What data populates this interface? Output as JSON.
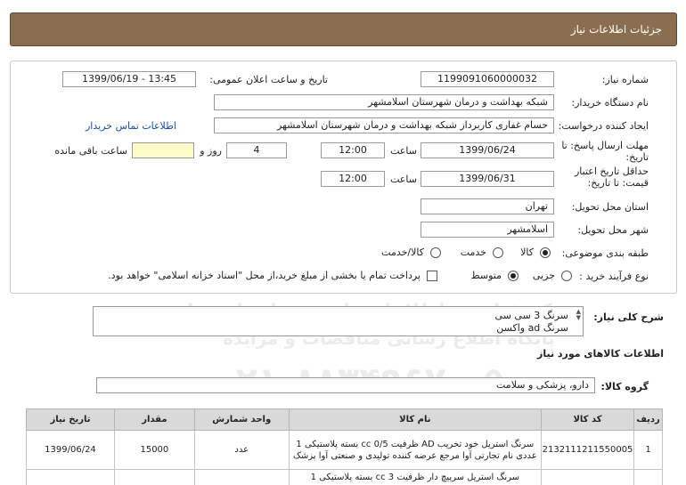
{
  "header": {
    "title": "جزئیات اطلاعات نیاز"
  },
  "form": {
    "need_number_label": "شماره نیاز:",
    "need_number": "1199091060000032",
    "announce_label": "تاریخ و ساعت اعلان عمومی:",
    "announce_value": "1399/06/19 - 13:45",
    "buyer_org_label": "نام دستگاه خریدار:",
    "buyer_org": "شبکه بهداشت و درمان شهرستان اسلامشهر",
    "creator_label": "ایجاد کننده درخواست:",
    "creator": "حسام غفاری کاربرداز شبکه بهداشت و درمان شهرستان اسلامشهر",
    "contact_link": "اطلاعات تماس خریدار",
    "deadline_label_1": "مهلت ارسال پاسخ: تا",
    "deadline_label_2": "تاریخ:",
    "deadline_date": "1399/06/24",
    "time_label": "ساعت",
    "deadline_time": "12:00",
    "days_value": "4",
    "days_label": "روز و",
    "remaining_value": "",
    "remaining_label": "ساعت باقی مانده",
    "validity_label_1": "حداقل تاریخ اعتبار",
    "validity_label_2": "قیمت: تا تاریخ:",
    "validity_date": "1399/06/31",
    "validity_time": "12:00",
    "province_label": "استان محل تحویل:",
    "province": "تهران",
    "city_label": "شهر محل تحویل:",
    "city": "اسلامشهر",
    "category_label": "طبقه بندی موضوعی:",
    "category_options": [
      "کالا",
      "خدمت",
      "کالا/خدمت"
    ],
    "category_selected": "کالا",
    "process_label": "نوع فرآیند خرید :",
    "process_options": [
      "جزیی",
      "متوسط"
    ],
    "process_selected": "متوسط",
    "payment_note": "پرداخت تمام یا بخشی از مبلغ خرید،از محل \"اسناد خزانه اسلامی\" خواهد بود."
  },
  "summary": {
    "label": "شرح کلی نیاز:",
    "line1": "سرنگ 3 سی سی",
    "line2": "سرنگ ad واکسن"
  },
  "goods_info_title": "اطلاعات کالاهای مورد نیاز",
  "goods_group": {
    "label": "گروه کالا:",
    "value": "دارو، پزشکی و سلامت"
  },
  "table": {
    "headers": [
      "ردیف",
      "کد کالا",
      "نام کالا",
      "واحد شمارش",
      "مقدار",
      "تاریخ نیاز"
    ],
    "rows": [
      {
        "index": "1",
        "code": "2132111211550005",
        "name": "سرنگ استریل خود تخریب AD ظرفیت cc 0/5 بسته پلاستیکی 1 عددی نام تجارتی آوا مرجع عرضه کننده تولیدی و صنعتی آوا پزشک",
        "unit": "عدد",
        "qty": "15000",
        "date": "1399/06/24"
      },
      {
        "index": "",
        "code": "",
        "name": "سرنگ استریل سرپیچ دار ظرفیت cc 3 بسته پلاستیکی 1",
        "unit": "",
        "qty": "",
        "date": ""
      }
    ]
  },
  "watermark": {
    "line1": "مرکز فناوری اطلاعات پارس نماد داده ها",
    "line2": "پایگاه اطلاع رسانی مناقصات و مزایده",
    "line3": "۰۲۱-۸۸۳۴۹۶۷۰-۵",
    "line4": "ParsNamadData"
  }
}
